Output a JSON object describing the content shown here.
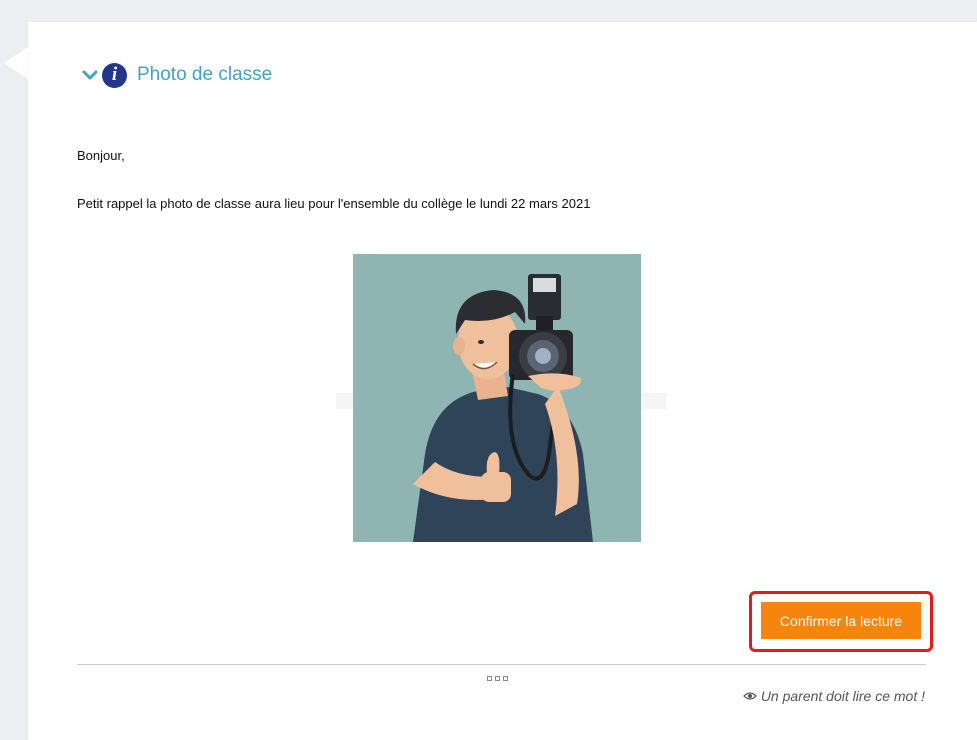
{
  "message": {
    "title": "Photo de classe",
    "greeting": "Bonjour,",
    "body": "Petit rappel la photo de classe aura lieu pour l'ensemble du collège le lundi 22 mars 2021"
  },
  "image": {
    "subject": "photographer-illustration",
    "background_color": "#8fb5b3"
  },
  "actions": {
    "confirm_label": "Confirmer la lecture",
    "confirm_color": "#f7850d"
  },
  "footer": {
    "notice": "Un parent doit lire ce mot !"
  },
  "colors": {
    "title": "#3fa2c9",
    "info_icon": "#23358d",
    "highlight": "#e31b1b"
  },
  "icons": {
    "collapse": "chevron-down-icon",
    "info": "info-icon",
    "eye": "eye-icon",
    "more": "more-dots-icon"
  }
}
